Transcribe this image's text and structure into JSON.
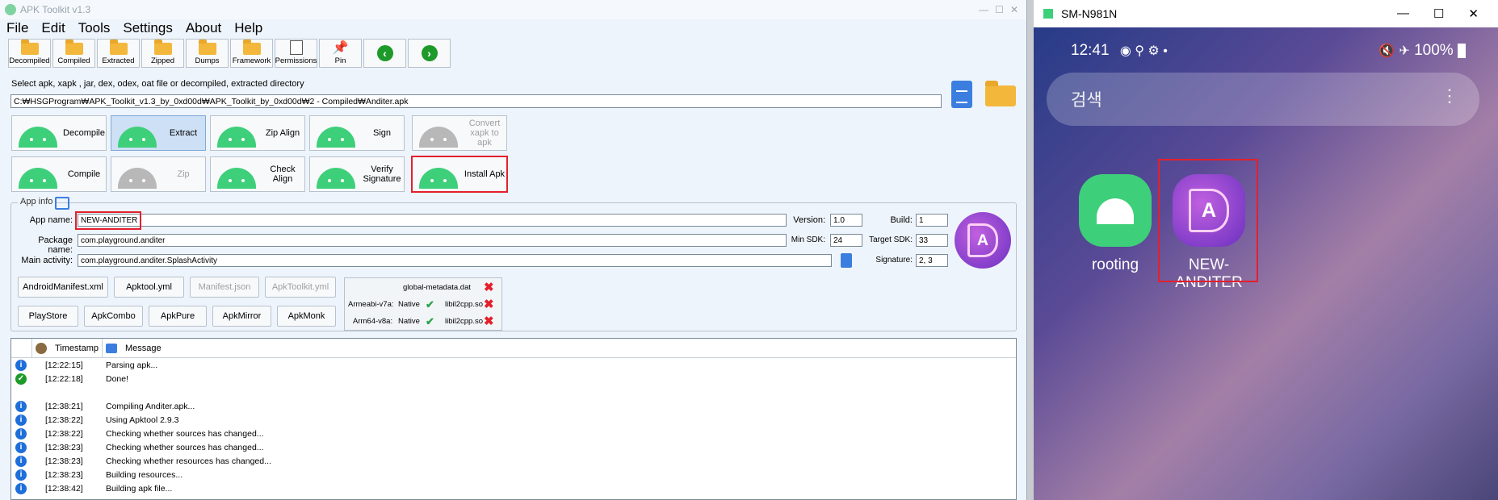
{
  "apk": {
    "title": "APK Toolkit v1.3",
    "menu": [
      "File",
      "Edit",
      "Tools",
      "Settings",
      "About",
      "Help"
    ],
    "toolbar": [
      "Decompiled",
      "Compiled",
      "Extracted",
      "Zipped",
      "Dumps",
      "Framework",
      "Permissions",
      "Pin"
    ],
    "hint": "Select apk, xapk , jar, dex, odex, oat file or decompiled, extracted directory",
    "path": "C:₩HSGProgram₩APK_Toolkit_v1.3_by_0xd00d₩APK_Toolkit_by_0xd00d₩2 - Compiled₩Anditer.apk",
    "actions": {
      "decompile": "Decompile",
      "extract": "Extract",
      "zipalign": "Zip Align",
      "sign": "Sign",
      "convert": "Convert xapk to apk",
      "compile": "Compile",
      "zip": "Zip",
      "check_align": "Check Align",
      "verify": "Verify Signature",
      "install": "Install Apk"
    },
    "appinfo": {
      "legend": "App info",
      "app_name_label": "App name:",
      "app_name": "NEW-ANDITER",
      "package_label": "Package name:",
      "package": "com.playground.anditer",
      "activity_label": "Main activity:",
      "activity": "com.playground.anditer.SplashActivity",
      "version_label": "Version:",
      "version": "1.0",
      "build_label": "Build:",
      "build": "1",
      "minsdk_label": "Min SDK:",
      "minsdk": "24",
      "targetsdk_label": "Target SDK:",
      "targetsdk": "33",
      "signature_label": "Signature:",
      "signature": "2, 3"
    },
    "buttons_row1": [
      "AndroidManifest.xml",
      "Apktool.yml",
      "Manifest.json",
      "ApkToolkit.yml"
    ],
    "buttons_row2": [
      "PlayStore",
      "ApkCombo",
      "ApkPure",
      "ApkMirror",
      "ApkMonk"
    ],
    "libs": {
      "metadata": "global-metadata.dat",
      "armeabi_label": "Armeabi-v7a:",
      "arm64_label": "Arm64-v8a:",
      "native": "Native",
      "lib": "libil2cpp.so"
    },
    "log": {
      "col_timestamp": "Timestamp",
      "col_message": "Message",
      "rows": [
        {
          "ts": "[12:22:15]",
          "msg": "Parsing apk..."
        },
        {
          "ts": "[12:22:18]",
          "msg": "Done!"
        },
        {
          "ts": "",
          "msg": ""
        },
        {
          "ts": "[12:38:21]",
          "msg": "Compiling Anditer.apk..."
        },
        {
          "ts": "[12:38:22]",
          "msg": "Using Apktool 2.9.3"
        },
        {
          "ts": "[12:38:22]",
          "msg": "Checking whether sources has changed..."
        },
        {
          "ts": "[12:38:23]",
          "msg": "Checking whether sources has changed..."
        },
        {
          "ts": "[12:38:23]",
          "msg": "Checking whether resources has changed..."
        },
        {
          "ts": "[12:38:23]",
          "msg": "Building resources..."
        },
        {
          "ts": "[12:38:42]",
          "msg": "Building apk file..."
        }
      ]
    }
  },
  "phone": {
    "title": "SM-N981N",
    "time": "12:41",
    "battery": "100%",
    "search_placeholder": "검색",
    "apps": [
      "rooting",
      "NEW-ANDITER"
    ]
  }
}
